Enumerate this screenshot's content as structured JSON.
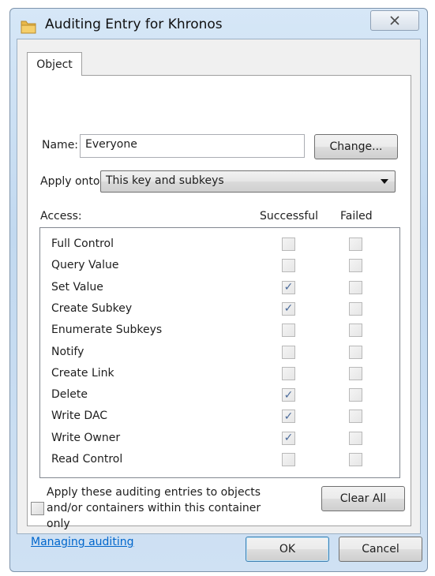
{
  "window": {
    "title": "Auditing Entry for Khronos",
    "close_glyph": "✕"
  },
  "tab": {
    "label": "Object"
  },
  "name_field": {
    "label": "Name:",
    "value": "Everyone",
    "change_label": "Change..."
  },
  "apply_onto": {
    "label": "Apply onto:",
    "selected": "This key and subkeys"
  },
  "access": {
    "label": "Access:",
    "col_successful": "Successful",
    "col_failed": "Failed",
    "permissions": [
      {
        "name": "Full Control",
        "successful": false,
        "failed": false
      },
      {
        "name": "Query Value",
        "successful": false,
        "failed": false
      },
      {
        "name": "Set Value",
        "successful": true,
        "failed": false
      },
      {
        "name": "Create Subkey",
        "successful": true,
        "failed": false
      },
      {
        "name": "Enumerate Subkeys",
        "successful": false,
        "failed": false
      },
      {
        "name": "Notify",
        "successful": false,
        "failed": false
      },
      {
        "name": "Create Link",
        "successful": false,
        "failed": false
      },
      {
        "name": "Delete",
        "successful": true,
        "failed": false
      },
      {
        "name": "Write DAC",
        "successful": true,
        "failed": false
      },
      {
        "name": "Write Owner",
        "successful": true,
        "failed": false
      },
      {
        "name": "Read Control",
        "successful": false,
        "failed": false
      }
    ]
  },
  "apply_inherit": {
    "label": "Apply these auditing entries to objects and/or containers within this container only",
    "checked": false
  },
  "clear_all_label": "Clear All",
  "managing_link": "Managing auditing",
  "ok_label": "OK",
  "cancel_label": "Cancel",
  "colors": {
    "link": "#0066cc",
    "check": "#4b6b9b",
    "frame": "#c2d9f0"
  }
}
